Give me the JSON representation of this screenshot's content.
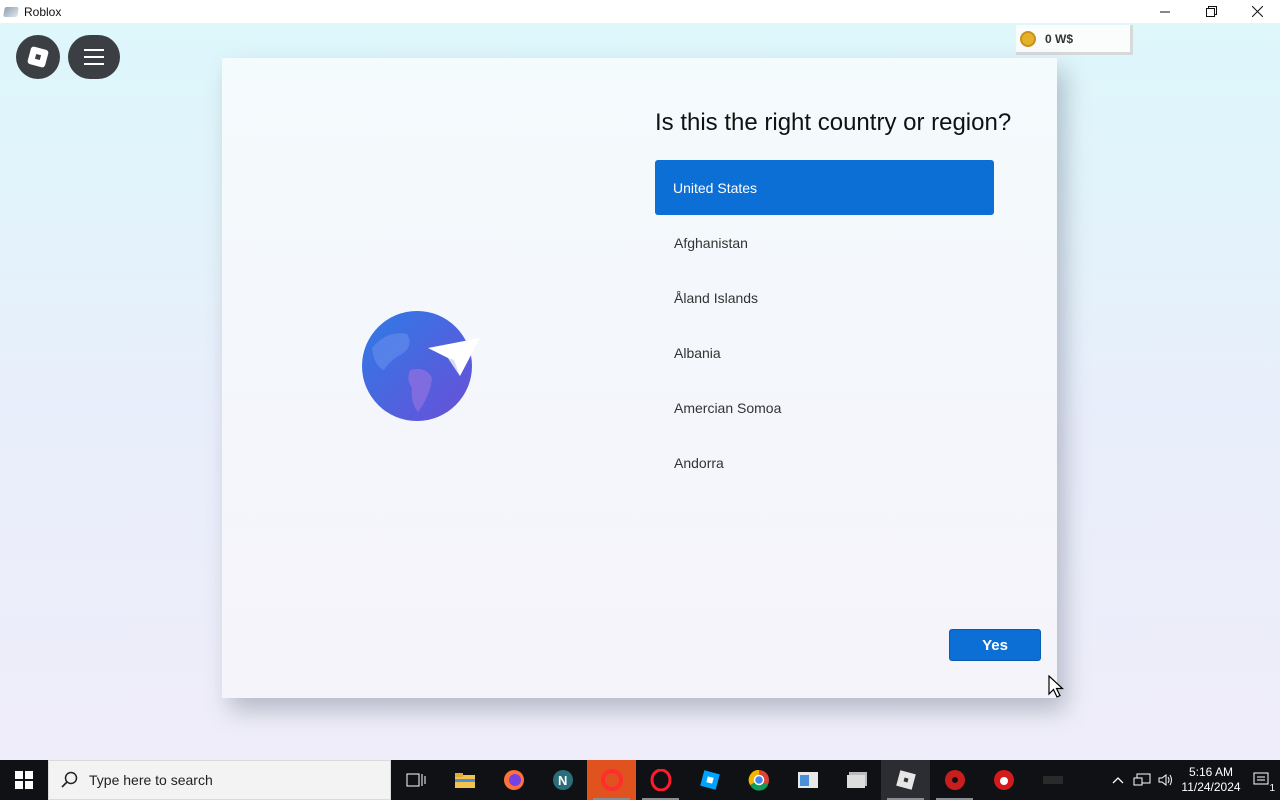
{
  "window": {
    "title": "Roblox"
  },
  "currency": {
    "amount": "0 W$"
  },
  "dialog": {
    "question": "Is this the right country or region?",
    "countries": [
      "United States",
      "Afghanistan",
      "Åland Islands",
      "Albania",
      "Amercian Somoa",
      "Andorra"
    ],
    "selected_index": 0,
    "yes_label": "Yes"
  },
  "taskbar": {
    "search_placeholder": "Type here to search",
    "time": "5:16 AM",
    "date": "11/24/2024",
    "notification_count": "1"
  },
  "colors": {
    "accent": "#0b6fd6",
    "taskbar": "#101115"
  }
}
